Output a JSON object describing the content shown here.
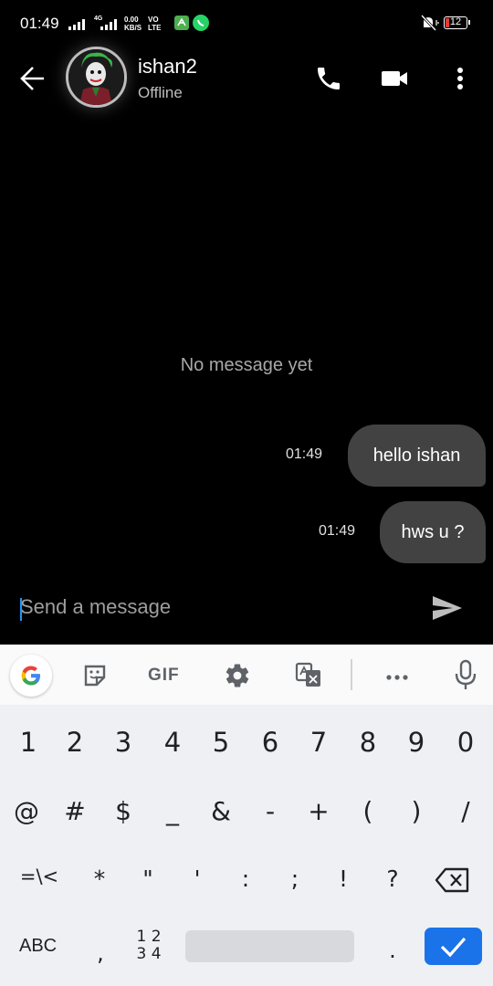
{
  "status_bar": {
    "time": "01:49",
    "network_type": "4G",
    "data_speed_value": "0.00",
    "data_speed_unit": "KB/S",
    "volte_top": "VO",
    "volte_bottom": "LTE",
    "battery_level": "12",
    "icons": [
      "signal-icon",
      "signal-4g-icon",
      "app-notification-icon",
      "whatsapp-icon",
      "mute-vibrate-icon",
      "battery-icon"
    ]
  },
  "header": {
    "contact_name": "ishan2",
    "contact_status": "Offline",
    "icons": [
      "back-arrow-icon",
      "phone-icon",
      "video-call-icon",
      "more-vert-icon"
    ]
  },
  "chat": {
    "empty_text": "No message yet",
    "messages": [
      {
        "time": "01:49",
        "text": "hello ishan"
      },
      {
        "time": "01:49",
        "text": "hws u ?"
      }
    ]
  },
  "composer": {
    "placeholder": "Send a message",
    "send_icon": "send-icon"
  },
  "keyboard": {
    "toolbar": [
      "google-icon",
      "sticker-icon",
      "gif-icon",
      "settings-gear-icon",
      "translate-icon",
      "more-horiz-icon",
      "microphone-icon"
    ],
    "gif_label": "GIF",
    "row1": [
      "1",
      "2",
      "3",
      "4",
      "5",
      "6",
      "7",
      "8",
      "9",
      "0"
    ],
    "row2": [
      "@",
      "#",
      "$",
      "_",
      "&",
      "-",
      "+",
      "(",
      ")",
      "/"
    ],
    "row3": [
      "=\\<",
      "*",
      "\"",
      "'",
      ":",
      ";",
      "!",
      "?"
    ],
    "bottom": {
      "abc": "ABC",
      "comma": ",",
      "nums_top": "1 2",
      "nums_bottom": "3 4",
      "period": "."
    },
    "accent_color": "#1a73e8"
  }
}
